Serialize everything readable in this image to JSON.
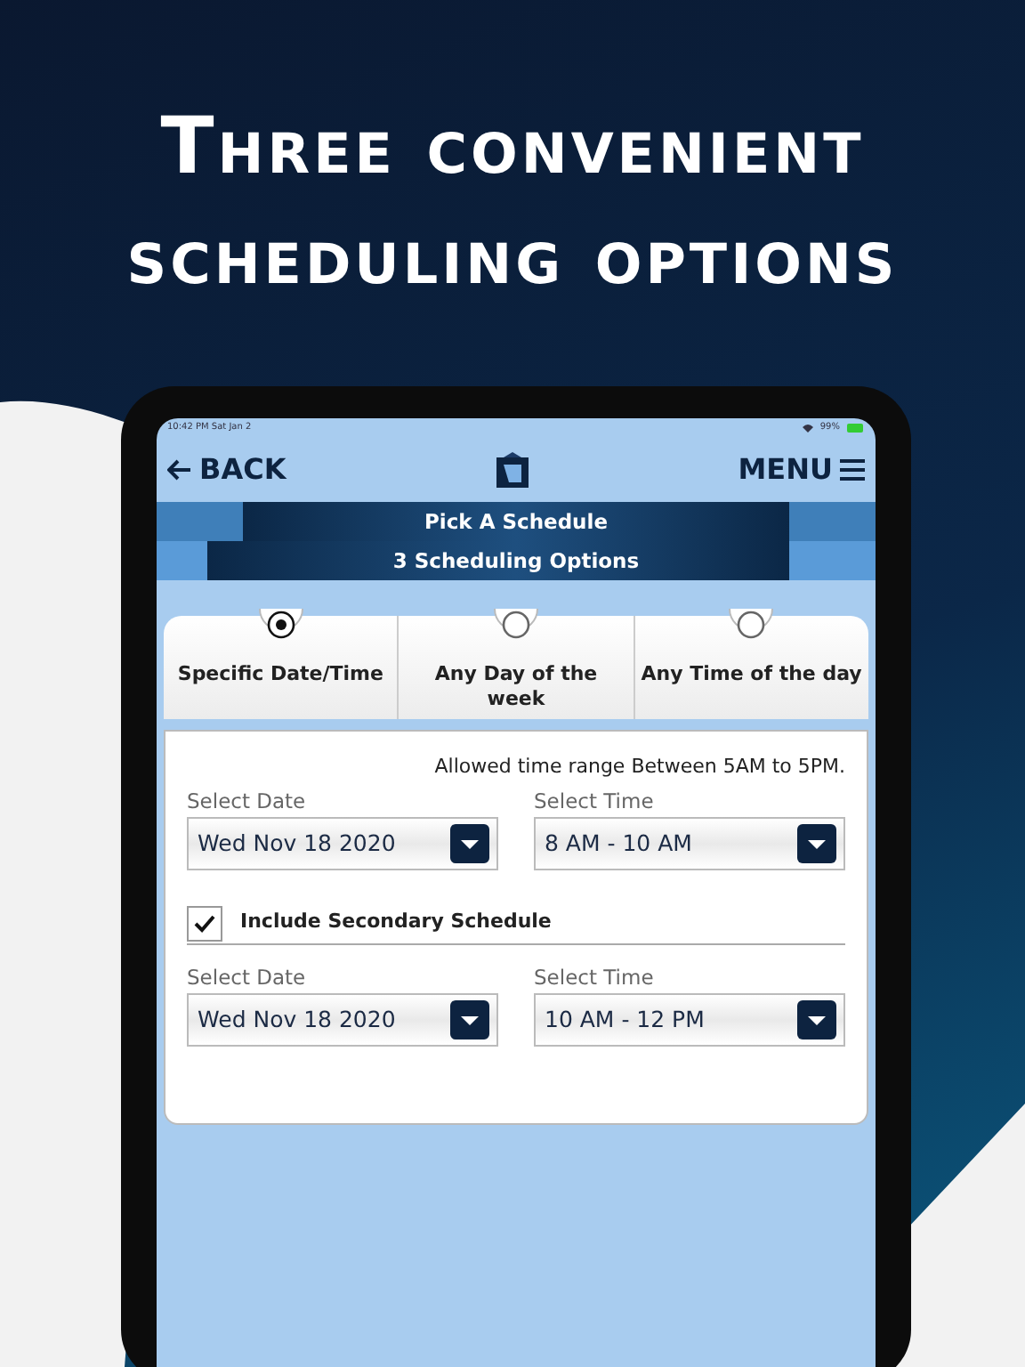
{
  "headline": "Three convenient scheduling options",
  "status_bar": {
    "time": "10:42 PM",
    "date": "Sat Jan 2",
    "battery": "99%"
  },
  "nav": {
    "back": "BACK",
    "menu": "MENU"
  },
  "banners": [
    "Pick A Schedule",
    "3 Scheduling Options"
  ],
  "options": [
    {
      "label": "Specific Date/Time",
      "selected": true
    },
    {
      "label": "Any Day of the week",
      "selected": false
    },
    {
      "label": "Any Time of the day",
      "selected": false
    }
  ],
  "note": "Allowed time range Between 5AM to 5PM.",
  "primary": {
    "fields": [
      {
        "label": "Select Date",
        "value": "Wed Nov 18 2020"
      },
      {
        "label": "Select Time",
        "value": "8 AM - 10 AM"
      }
    ]
  },
  "secondary": {
    "label": "Include Secondary Schedule",
    "checked": true,
    "fields": [
      {
        "label": "Select Date",
        "value": "Wed Nov 18 2020"
      },
      {
        "label": "Select Time",
        "value": "10 AM - 12 PM"
      }
    ]
  }
}
